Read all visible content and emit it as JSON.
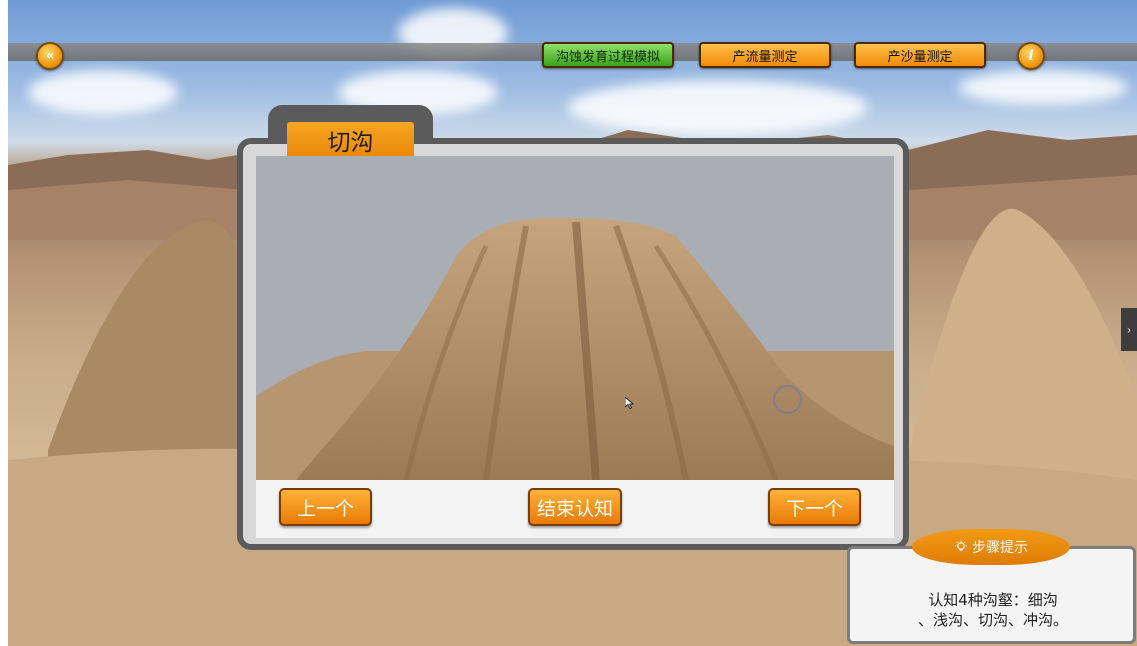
{
  "topbar": {
    "collapse_icon": "«",
    "info_icon": "i",
    "nav": [
      {
        "label": "沟蚀发育过程模拟",
        "active": true
      },
      {
        "label": "产流量测定",
        "active": false
      },
      {
        "label": "产沙量测定",
        "active": false
      }
    ]
  },
  "panel": {
    "tab_title": "切沟",
    "buttons": {
      "prev": "上一个",
      "finish": "结束认知",
      "next": "下一个"
    }
  },
  "hint": {
    "icon": "lightbulb-icon",
    "title": "步骤提示",
    "line1": "认知4种沟壑：细沟",
    "line2": "、浅沟、切沟、冲沟。"
  },
  "side_tab": {
    "icon": "›"
  },
  "colors": {
    "accent_orange": "#f28a08",
    "active_green": "#3aa31a",
    "panel_frame": "#5b5b5b"
  }
}
